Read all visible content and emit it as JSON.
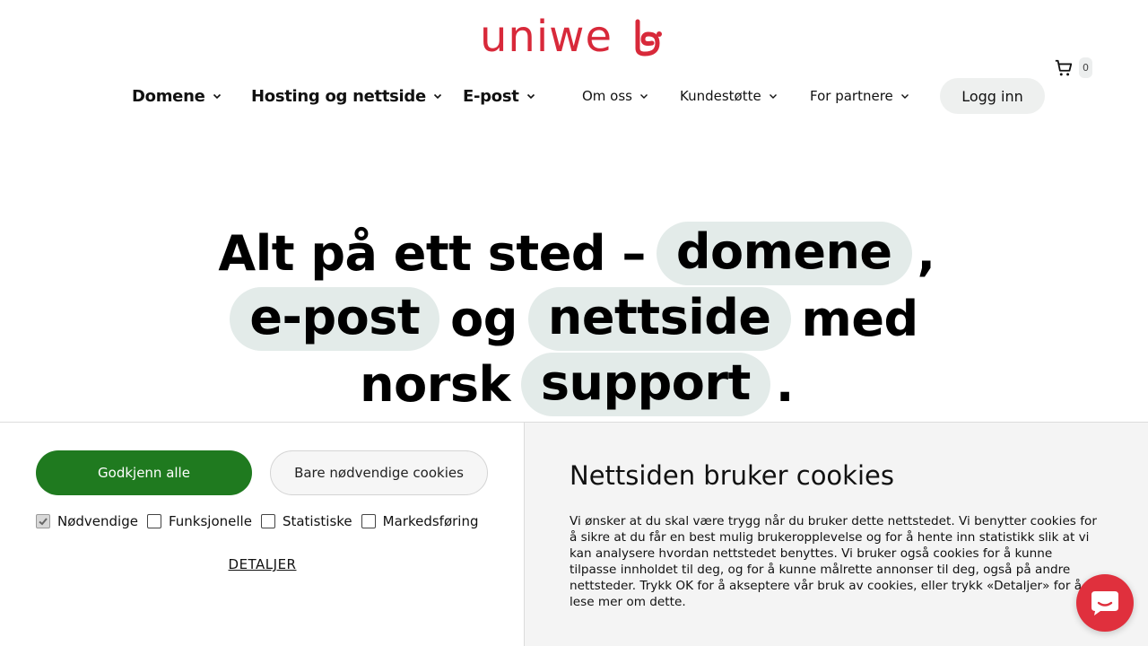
{
  "brand": {
    "logo_text": "uniweb",
    "accent_color": "#d8293a",
    "logo_icon": "uniweb-logo"
  },
  "cart": {
    "icon": "cart-icon",
    "count": "0"
  },
  "nav": {
    "primary": [
      {
        "label": "Domene"
      },
      {
        "label": "Hosting og nettside"
      },
      {
        "label": "E-post"
      }
    ],
    "secondary": [
      {
        "label": "Om oss"
      },
      {
        "label": "Kundestøtte"
      },
      {
        "label": "For partnere"
      }
    ],
    "login_label": "Logg inn"
  },
  "hero": {
    "line1_text": "Alt på ett sted –",
    "line1_pill": "domene",
    "line1_end": ",",
    "line2_pill1": "e-post",
    "line2_mid": "og",
    "line2_pill2": "nettside",
    "line2_end": "med",
    "line3_text": "norsk",
    "line3_pill": "support",
    "line3_end": ".",
    "pill_color": "#e3ebe9"
  },
  "cookie": {
    "accept_all_label": "Godkjenn alle",
    "necessary_only_label": "Bare nødvendige cookies",
    "accept_color": "#1f7a1f",
    "checkboxes": [
      {
        "label": "Nødvendige",
        "checked": true
      },
      {
        "label": "Funksjonelle",
        "checked": false
      },
      {
        "label": "Statistiske",
        "checked": false
      },
      {
        "label": "Markedsføring",
        "checked": false
      }
    ],
    "details_label": "DETALJER",
    "title": "Nettsiden bruker cookies",
    "body": "Vi ønsker at du skal være trygg når du bruker dette nettstedet. Vi benytter cookies for å sikre at du får en best mulig brukeropplevelse og for å hente inn statistikk slik at vi kan analysere hvordan nettstedet benyttes. Vi bruker også cookies for å kunne tilpasse innholdet til deg, og for å kunne målrette annonser til deg, også på andre nettsteder. Trykk OK for å akseptere vår bruk av cookies, eller trykk «Detaljer» for å lese mer om dette."
  },
  "chat": {
    "icon": "chat-icon",
    "color": "#e0303d"
  }
}
